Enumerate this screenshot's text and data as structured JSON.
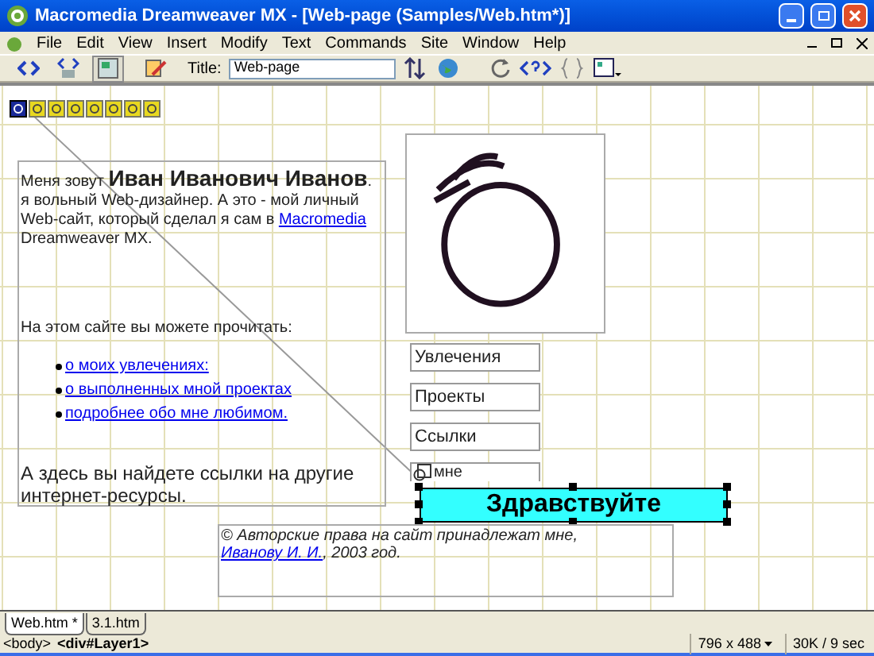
{
  "window": {
    "title": "Macromedia Dreamweaver MX - [Web-page (Samples/Web.htm*)]"
  },
  "menu": [
    "File",
    "Edit",
    "View",
    "Insert",
    "Modify",
    "Text",
    "Commands",
    "Site",
    "Window",
    "Help"
  ],
  "toolbar": {
    "views": [
      {
        "kind": "code",
        "selected": false
      },
      {
        "kind": "split",
        "selected": false
      },
      {
        "kind": "design",
        "selected": true
      }
    ],
    "title_label": "Title:",
    "title_value": "Web-page"
  },
  "layer_markers": [
    {
      "selected": true
    },
    {
      "selected": false
    },
    {
      "selected": false
    },
    {
      "selected": false
    },
    {
      "selected": false
    },
    {
      "selected": false
    },
    {
      "selected": false
    },
    {
      "selected": false
    }
  ],
  "intro": [
    {
      "kind": "text",
      "text": "Меня зовут "
    },
    {
      "kind": "name",
      "text": "Иван Иванович Иванов"
    },
    {
      "kind": "text",
      "text": ". я вольный Web-дизайнер. А это - мой личный Web-сайт, который сделал я сам в "
    },
    {
      "kind": "link",
      "text": "Macromedia"
    },
    {
      "kind": "text",
      "text": " Dreamweaver MX."
    }
  ],
  "read_heading": "На этом сайте вы можете прочитать:",
  "links": [
    "о моих увлечениях:",
    "о выполненных мной проектах",
    "подробнее обо мне любимом."
  ],
  "resources_text": "А здесь вы найдете ссылки на другие интернет-ресурсы.",
  "nav_buttons": [
    "Увлечения",
    "Проекты",
    "Ссылки",
    "мне"
  ],
  "greeting_button": "Здравствуйте",
  "footer": [
    {
      "kind": "text",
      "text": "© Авторские права на сайт принадлежат мне, "
    },
    {
      "kind": "link",
      "text": "Иванову И. И."
    },
    {
      "kind": "text",
      "text": ", 2003 год."
    }
  ],
  "tabs": [
    {
      "label": "Web.htm *",
      "selected": true
    },
    {
      "label": "3.1.htm",
      "selected": false
    }
  ],
  "status_bar": {
    "tags": [
      {
        "text": "<body>",
        "selected": false
      },
      {
        "text": "<div#Layer1>",
        "selected": true
      }
    ],
    "window_size": "796 x 488",
    "download": "30K / 9 sec"
  }
}
